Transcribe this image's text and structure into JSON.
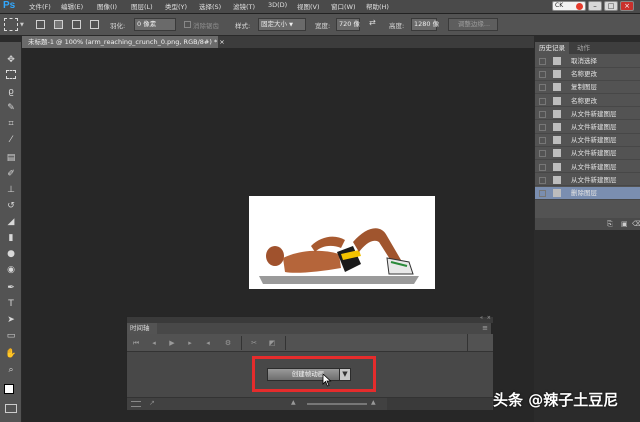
{
  "app": {
    "logo": "Ps"
  },
  "menu": [
    "文件(F)",
    "编辑(E)",
    "图像(I)",
    "图层(L)",
    "类型(Y)",
    "选择(S)",
    "滤镜(T)",
    "3D(D)",
    "视图(V)",
    "窗口(W)",
    "帮助(H)"
  ],
  "window_controls": {
    "ck_label": "CK",
    "minimize": "–",
    "maximize": "□",
    "close": "×"
  },
  "options": {
    "feather_label": "羽化:",
    "feather_value": "0 像素",
    "antialias_label": "消除锯齿",
    "style_label": "样式:",
    "style_value": "固定大小",
    "width_label": "宽度:",
    "width_value": "720 像",
    "height_label": "高度:",
    "height_value": "1280 像",
    "refine_edge": "调整边缘..."
  },
  "document": {
    "tab_title": "未标题-1 @ 100% (arm_reaching_crunch_0.png, RGB/8#) *",
    "tab_close": "×"
  },
  "history": {
    "tabs": [
      "历史记录",
      "动作"
    ],
    "items": [
      {
        "label": "取消选择",
        "selected": false
      },
      {
        "label": "名称更改",
        "selected": false
      },
      {
        "label": "复制图层",
        "selected": false
      },
      {
        "label": "名称更改",
        "selected": false
      },
      {
        "label": "从文件新建图层",
        "selected": false
      },
      {
        "label": "从文件新建图层",
        "selected": false
      },
      {
        "label": "从文件新建图层",
        "selected": false
      },
      {
        "label": "从文件新建图层",
        "selected": false
      },
      {
        "label": "从文件新建图层",
        "selected": false
      },
      {
        "label": "从文件新建图层",
        "selected": false
      },
      {
        "label": "删除图层",
        "selected": true
      }
    ]
  },
  "timeline": {
    "tab": "时间轴",
    "create_button": "创建帧动画",
    "dropdown_arrow": "▼"
  },
  "watermark": "头条 @辣子土豆尼",
  "colors": {
    "accent_ps": "#31a8ff",
    "highlight": "#e52c2c",
    "selected_row": "#7a8eb0"
  }
}
